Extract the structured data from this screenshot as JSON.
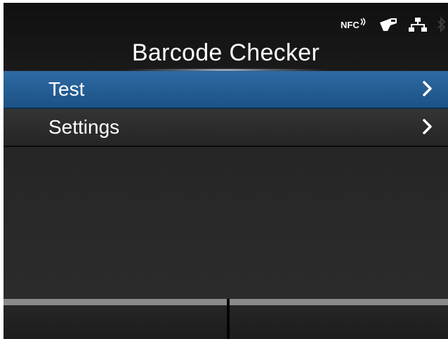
{
  "status_bar": {
    "nfc_label": "NFC",
    "icons": [
      "nfc-icon",
      "barcode-checker-icon",
      "network-icon",
      "bluetooth-icon"
    ]
  },
  "header": {
    "title": "Barcode Checker"
  },
  "menu": {
    "items": [
      {
        "label": "Test",
        "selected": true,
        "icon": "chevron-right-icon"
      },
      {
        "label": "Settings",
        "selected": false,
        "icon": "chevron-right-icon"
      }
    ]
  },
  "softkeys": {
    "left_label": "",
    "right_label": ""
  },
  "colors": {
    "selected_bg": "#2466a0",
    "background": "#232323",
    "text": "#ffffff"
  }
}
